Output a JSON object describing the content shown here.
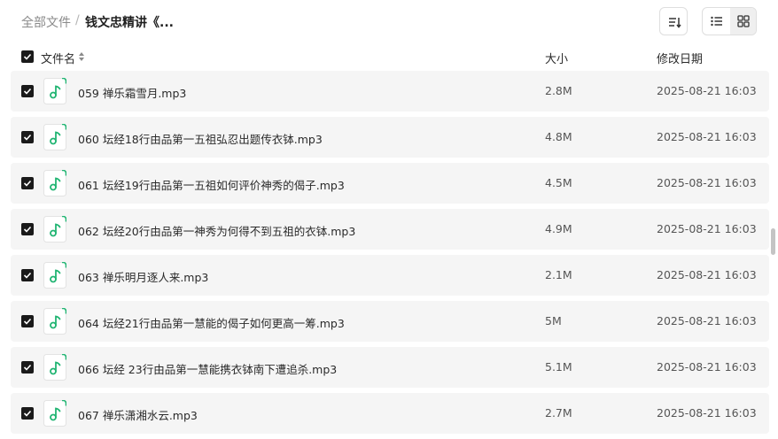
{
  "breadcrumb": {
    "root": "全部文件",
    "separator": "/",
    "current": "钱文忠精讲《..."
  },
  "columns": {
    "name": "文件名",
    "size": "大小",
    "modified": "修改日期"
  },
  "files": [
    {
      "name": "059 禅乐霜雪月.mp3",
      "size": "2.8M",
      "date": "2025-08-21 16:03"
    },
    {
      "name": "060 坛经18行由品第一五祖弘忍出题传衣钵.mp3",
      "size": "4.8M",
      "date": "2025-08-21 16:03"
    },
    {
      "name": "061 坛经19行由品第一五祖如何评价神秀的偈子.mp3",
      "size": "4.5M",
      "date": "2025-08-21 16:03"
    },
    {
      "name": "062 坛经20行由品第一神秀为何得不到五祖的衣钵.mp3",
      "size": "4.9M",
      "date": "2025-08-21 16:03"
    },
    {
      "name": "063 禅乐明月逐人来.mp3",
      "size": "2.1M",
      "date": "2025-08-21 16:03"
    },
    {
      "name": "064 坛经21行由品第一慧能的偈子如何更高一筹.mp3",
      "size": "5M",
      "date": "2025-08-21 16:03"
    },
    {
      "name": "066 坛经 23行由品第一慧能携衣钵南下遭追杀.mp3",
      "size": "5.1M",
      "date": "2025-08-21 16:03"
    },
    {
      "name": "067 禅乐潇湘水云.mp3",
      "size": "2.7M",
      "date": "2025-08-21 16:03"
    }
  ],
  "icons": {
    "file": "music-file-icon",
    "sort": "sort-icon",
    "list_view": "list-view-icon",
    "grid_view": "grid-view-icon"
  },
  "colors": {
    "accent": "#22b573",
    "row_bg": "#f5f5f5",
    "checkbox": "#1a1a1a"
  }
}
